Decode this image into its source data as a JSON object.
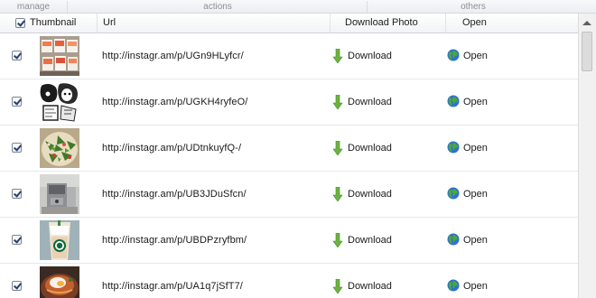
{
  "ribbon": {
    "groups": [
      {
        "label": "manage"
      },
      {
        "label": "actions"
      },
      {
        "label": "others"
      }
    ]
  },
  "table": {
    "headers": {
      "thumbnail": "Thumbnail",
      "url": "Url",
      "download": "Download Photo",
      "open": "Open"
    },
    "rows": [
      {
        "url": "http://instagr.am/p/UGn9HLyfcr/",
        "download": "Download",
        "open": "Open",
        "checked": true,
        "thumb": "sushi"
      },
      {
        "url": "http://instagr.am/p/UGKH4ryfeO/",
        "download": "Download",
        "open": "Open",
        "checked": true,
        "thumb": "manga"
      },
      {
        "url": "http://instagr.am/p/UDtnkuyfQ-/",
        "download": "Download",
        "open": "Open",
        "checked": true,
        "thumb": "salad"
      },
      {
        "url": "http://instagr.am/p/UB3JDuSfcn/",
        "download": "Download",
        "open": "Open",
        "checked": true,
        "thumb": "appliance"
      },
      {
        "url": "http://instagr.am/p/UBDPzryfbm/",
        "download": "Download",
        "open": "Open",
        "checked": true,
        "thumb": "coffee"
      },
      {
        "url": "http://instagr.am/p/UA1q7jSfT7/",
        "download": "Download",
        "open": "Open",
        "checked": true,
        "thumb": "bowl"
      }
    ]
  },
  "icons": {
    "download": "green-down-arrow-icon",
    "open": "globe-icon"
  },
  "colors": {
    "download_arrow": "#6cb33f",
    "globe_blue": "#2f73c9",
    "globe_green": "#4aa83a",
    "row_divider": "#e6e8eb"
  }
}
